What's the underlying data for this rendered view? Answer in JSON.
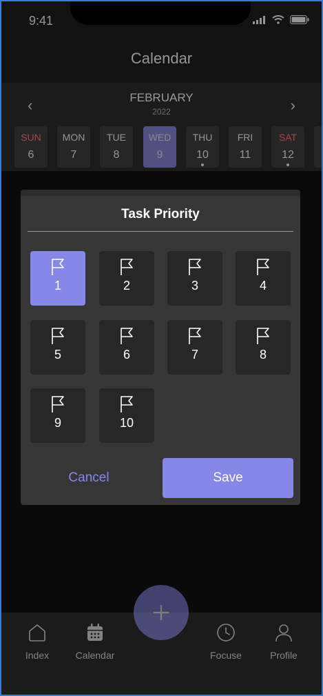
{
  "status_bar": {
    "time": "9:41"
  },
  "header": {
    "title": "Calendar"
  },
  "calendar": {
    "month": "FEBRUARY",
    "year": "2022",
    "days": [
      {
        "name": "SUN",
        "num": "6"
      },
      {
        "name": "MON",
        "num": "7"
      },
      {
        "name": "TUE",
        "num": "8"
      },
      {
        "name": "WED",
        "num": "9"
      },
      {
        "name": "THU",
        "num": "10"
      },
      {
        "name": "FRI",
        "num": "11"
      },
      {
        "name": "SAT",
        "num": "12"
      }
    ]
  },
  "dialog": {
    "title": "Task Priority",
    "priorities": [
      "1",
      "2",
      "3",
      "4",
      "5",
      "6",
      "7",
      "8",
      "9",
      "10"
    ],
    "selected_priority": "1",
    "cancel_label": "Cancel",
    "save_label": "Save"
  },
  "tabbar": {
    "items": [
      {
        "label": "Index",
        "icon": "home-icon"
      },
      {
        "label": "Calendar",
        "icon": "calendar-icon"
      },
      {
        "label": "Focuse",
        "icon": "clock-icon"
      },
      {
        "label": "Profile",
        "icon": "user-icon"
      }
    ],
    "fab_icon": "plus-icon"
  },
  "colors": {
    "accent": "#8687e7",
    "background": "#121212",
    "dialog": "#363636",
    "weekend": "#ff5a5a"
  }
}
